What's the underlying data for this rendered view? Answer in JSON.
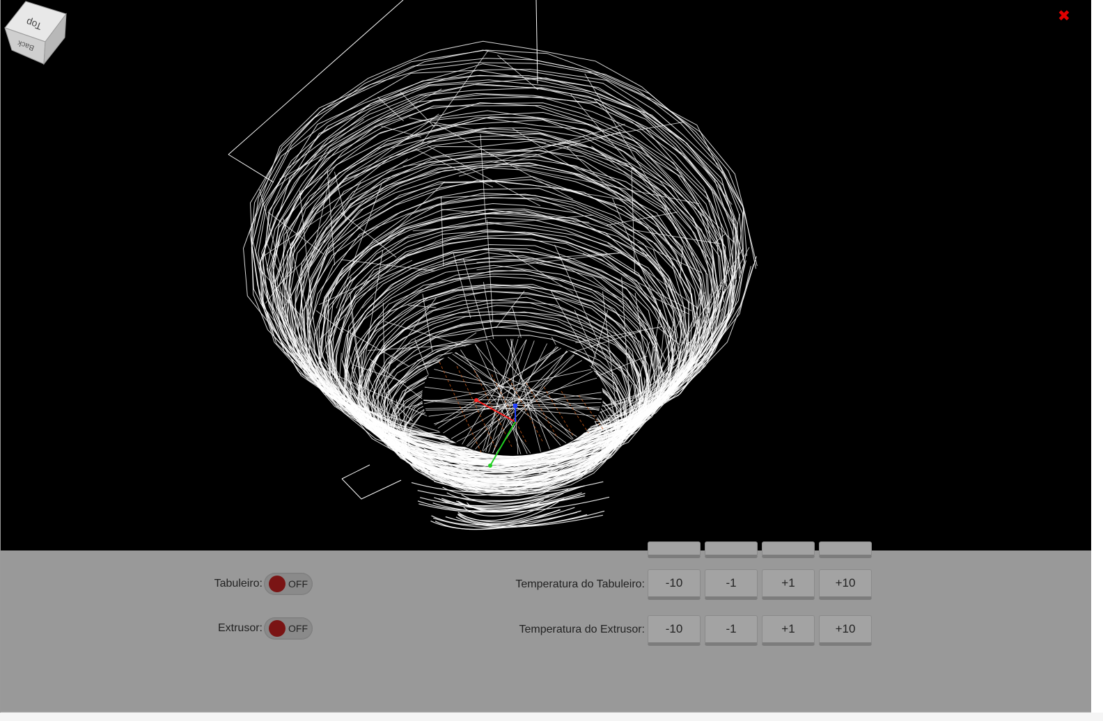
{
  "viewer": {
    "cube_top": "Top",
    "cube_back": "Back",
    "close_symbol": "✖"
  },
  "toggles": [
    {
      "label": "Tabuleiro:",
      "state": "OFF"
    },
    {
      "label": "Extrusor:",
      "state": "OFF"
    }
  ],
  "temperature": [
    {
      "label": "Temperatura do Tabuleiro:",
      "buttons": [
        "-10",
        "-1",
        "+1",
        "+10"
      ]
    },
    {
      "label": "Temperatura do Extrusor:",
      "buttons": [
        "-10",
        "-1",
        "+1",
        "+10"
      ]
    }
  ],
  "colors": {
    "viewport_bg": "#000000",
    "toolpath": "#ffffff",
    "toggle_off": "#7a1414",
    "close": "#e00000",
    "axis_x": "#ff2020",
    "axis_y": "#20d020",
    "axis_z": "#2040ff",
    "bed_grid": "#c85a1a"
  }
}
